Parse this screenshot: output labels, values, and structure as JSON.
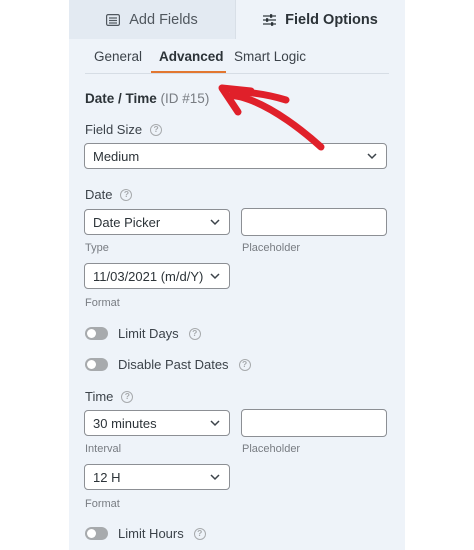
{
  "top_tabs": {
    "add_fields": "Add Fields",
    "field_options": "Field Options"
  },
  "sub_tabs": {
    "general": "General",
    "advanced": "Advanced",
    "smart_logic": "Smart Logic"
  },
  "section": {
    "title": "Date / Time",
    "id_label": "(ID #15)"
  },
  "field_size": {
    "label": "Field Size",
    "value": "Medium"
  },
  "date": {
    "label": "Date",
    "type_value": "Date Picker",
    "type_label": "Type",
    "placeholder_value": "",
    "placeholder_label": "Placeholder",
    "format_value": "11/03/2021 (m/d/Y)",
    "format_label": "Format"
  },
  "toggles": {
    "limit_days": "Limit Days",
    "disable_past_dates": "Disable Past Dates",
    "limit_hours": "Limit Hours"
  },
  "time": {
    "label": "Time",
    "interval_value": "30 minutes",
    "interval_label": "Interval",
    "placeholder_value": "",
    "placeholder_label": "Placeholder",
    "format_value": "12 H",
    "format_label": "Format"
  },
  "colors": {
    "accent": "#e27730",
    "arrow": "#e0202a",
    "panel_bg": "#eef3f9"
  },
  "icons": {
    "add_fields": "list-icon",
    "field_options": "sliders-icon",
    "help": "question-circle-icon",
    "dropdown": "chevron-down-icon"
  }
}
